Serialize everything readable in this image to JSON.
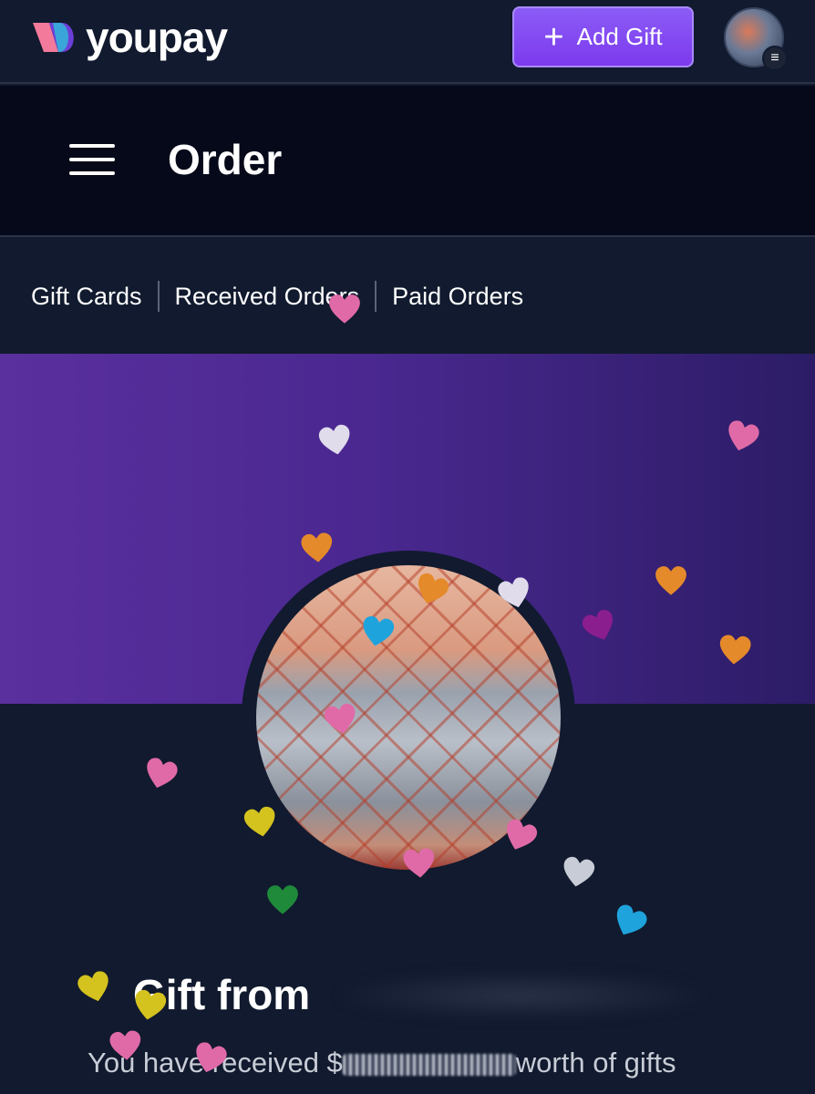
{
  "app": {
    "brand": "youpay"
  },
  "topbar": {
    "add_gift_label": "Add Gift",
    "add_gift_icon": "plus-icon"
  },
  "header": {
    "title": "Order",
    "menu_icon": "hamburger-icon"
  },
  "tabs": [
    {
      "label": "Gift Cards"
    },
    {
      "label": "Received Orders"
    },
    {
      "label": "Paid Orders"
    }
  ],
  "gift": {
    "title": "Gift from",
    "sender_name": "",
    "subtitle_prefix": "You have received $",
    "subtitle_suffix": "worth of gifts"
  },
  "colors": {
    "accent": "#7c3aed",
    "hero_start": "#5a2f9e",
    "hero_end": "#2c1c66",
    "background": "#111a2e"
  },
  "confetti_hearts": [
    {
      "color": "#e0dcec"
    },
    {
      "color": "#e06aa8"
    },
    {
      "color": "#e58a2a"
    },
    {
      "color": "#e58a2a"
    },
    {
      "color": "#e58a2a"
    },
    {
      "color": "#e0dcec"
    },
    {
      "color": "#1fa3dc"
    },
    {
      "color": "#8a1e8e"
    },
    {
      "color": "#e58a2a"
    },
    {
      "color": "#e06aa8"
    },
    {
      "color": "#e06aa8"
    },
    {
      "color": "#d4c21e"
    },
    {
      "color": "#1e8a3a"
    },
    {
      "color": "#e06aa8"
    },
    {
      "color": "#e06aa8"
    },
    {
      "color": "#c8ccd6"
    },
    {
      "color": "#1fa3dc"
    },
    {
      "color": "#d4c21e"
    },
    {
      "color": "#d4c21e"
    },
    {
      "color": "#e06aa8"
    },
    {
      "color": "#e06aa8"
    },
    {
      "color": "#e06aa8"
    }
  ]
}
